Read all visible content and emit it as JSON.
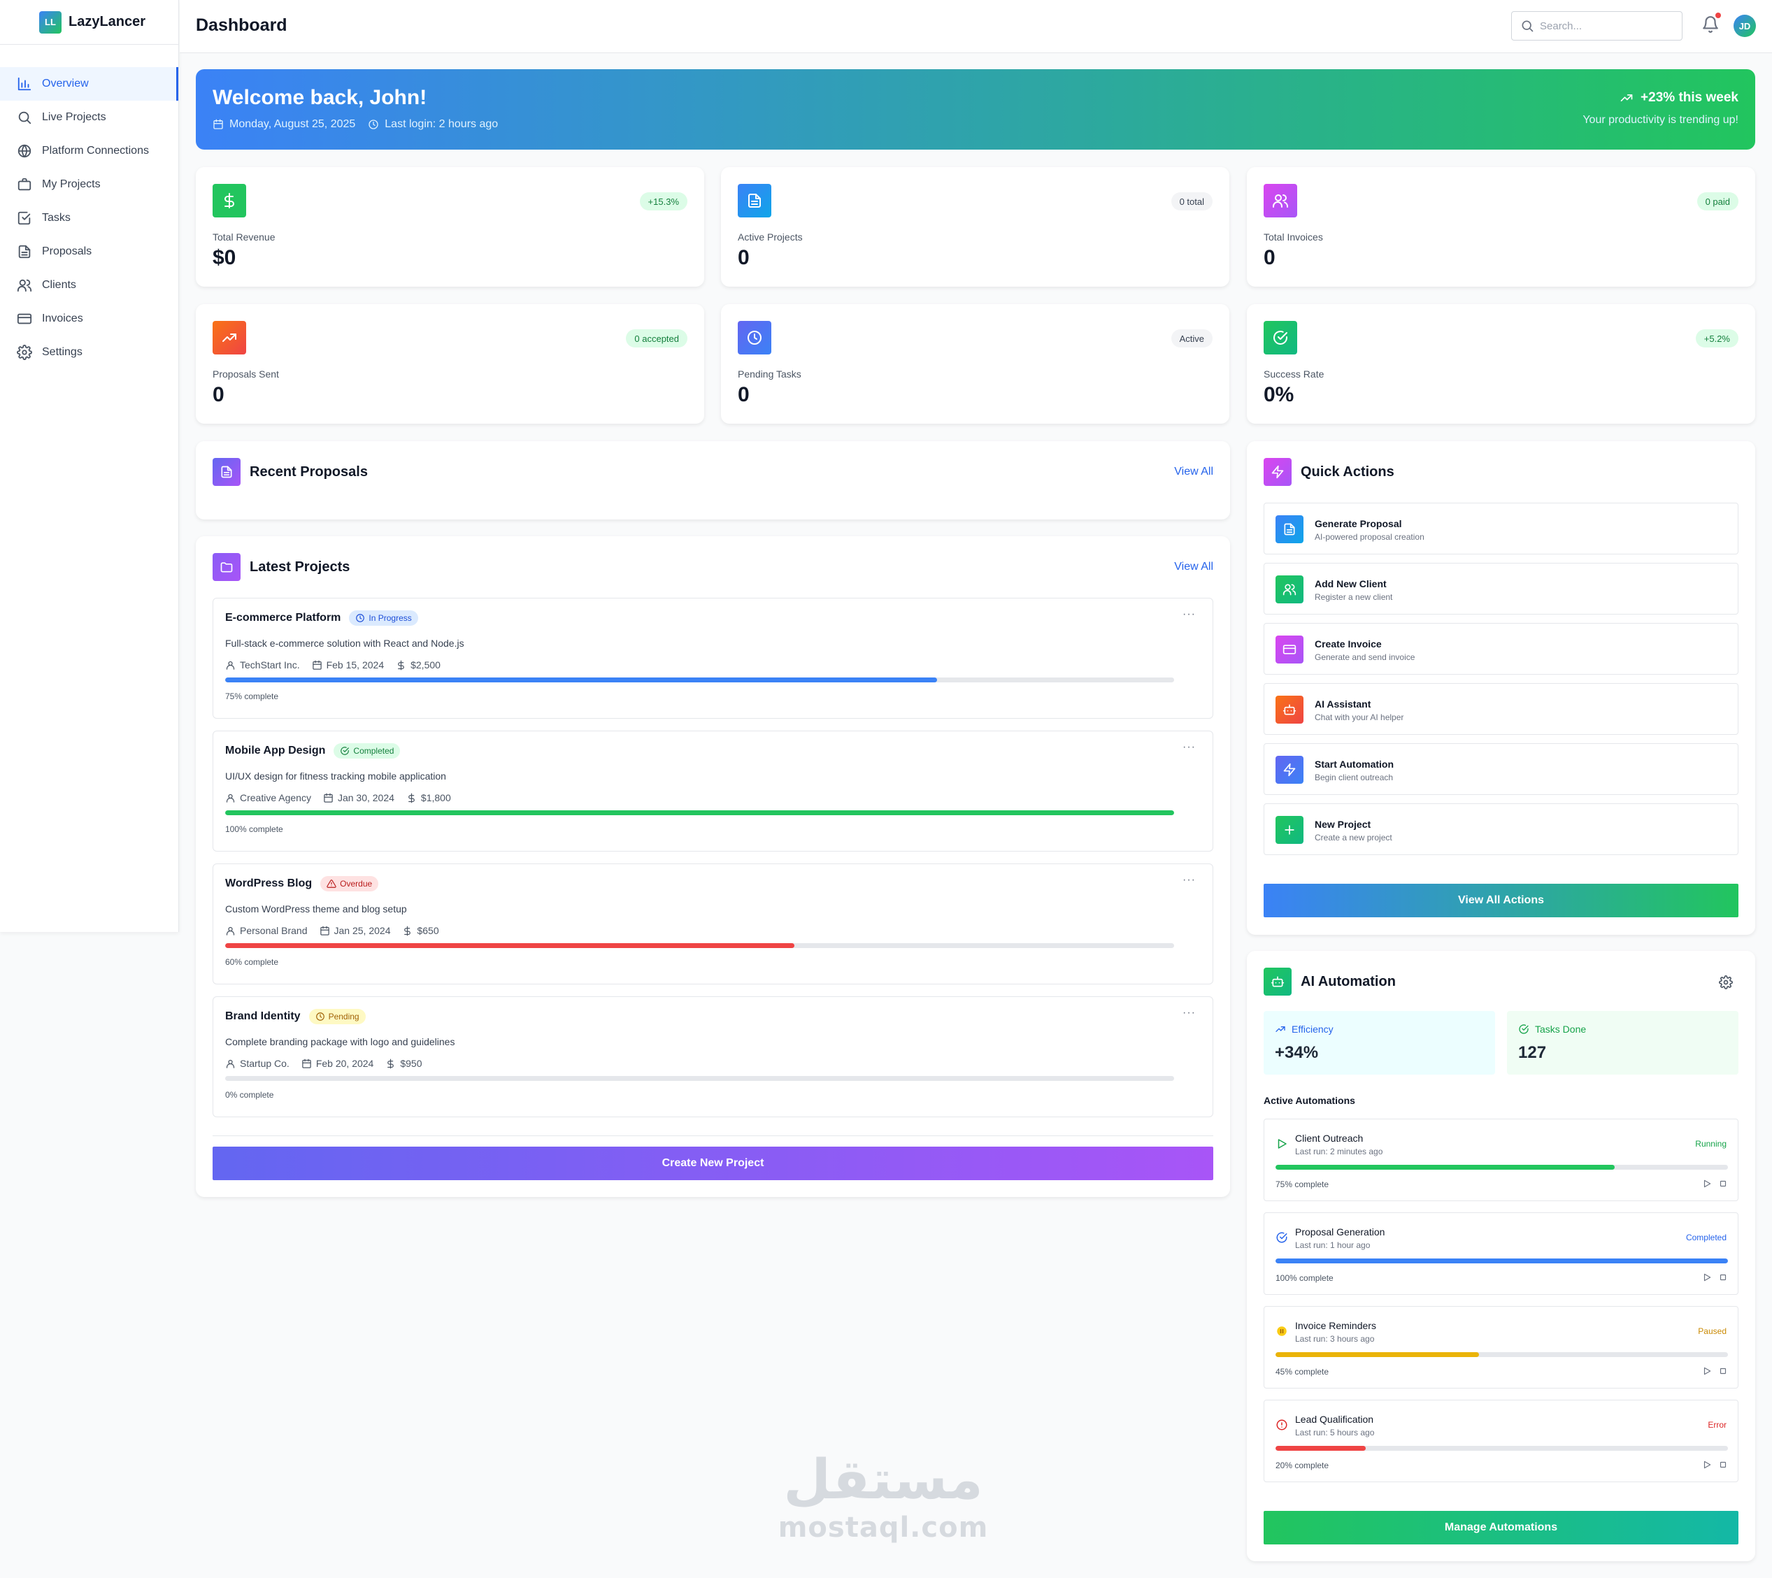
{
  "app": {
    "name": "LazyLancer",
    "logo_text": "LL"
  },
  "sidebar": {
    "items": [
      {
        "label": "Overview",
        "icon": "bar-chart-icon",
        "active": true
      },
      {
        "label": "Live Projects",
        "icon": "search-icon"
      },
      {
        "label": "Platform Connections",
        "icon": "globe-icon"
      },
      {
        "label": "My Projects",
        "icon": "briefcase-icon"
      },
      {
        "label": "Tasks",
        "icon": "check-square-icon"
      },
      {
        "label": "Proposals",
        "icon": "file-text-icon"
      },
      {
        "label": "Clients",
        "icon": "users-icon"
      },
      {
        "label": "Invoices",
        "icon": "credit-card-icon"
      },
      {
        "label": "Settings",
        "icon": "gear-icon"
      }
    ]
  },
  "header": {
    "title": "Dashboard",
    "search_placeholder": "Search...",
    "avatar_initials": "JD"
  },
  "welcome": {
    "title": "Welcome back, John!",
    "date": "Monday, August 25, 2025",
    "last_login": "Last login: 2 hours ago",
    "trend": "+23% this week",
    "trend_sub": "Your productivity is trending up!"
  },
  "stats": [
    {
      "label": "Total Revenue",
      "value": "$0",
      "badge": "+15.3%",
      "icon": "dollar-icon",
      "color": "#22c55e"
    },
    {
      "label": "Active Projects",
      "value": "0",
      "badge": "0 total",
      "icon": "file-text-icon",
      "color": "#3b82f6"
    },
    {
      "label": "Total Invoices",
      "value": "0",
      "badge": "0 paid",
      "icon": "users-icon",
      "color": "#d946ef"
    },
    {
      "label": "Proposals Sent",
      "value": "0",
      "badge": "0 accepted",
      "icon": "trending-up-icon",
      "color": "#f97316"
    },
    {
      "label": "Pending Tasks",
      "value": "0",
      "badge": "Active",
      "icon": "clock-icon",
      "color": "#6366f1"
    },
    {
      "label": "Success Rate",
      "value": "0%",
      "badge": "+5.2%",
      "icon": "check-circle-icon",
      "color": "#10b981"
    }
  ],
  "recent_proposals": {
    "title": "Recent Proposals",
    "view_all": "View All"
  },
  "latest_projects": {
    "title": "Latest Projects",
    "view_all": "View All",
    "create_button": "Create New Project",
    "items": [
      {
        "name": "E-commerce Platform",
        "status": "In Progress",
        "desc": "Full-stack e-commerce solution with React and Node.js",
        "client": "TechStart Inc.",
        "date": "Feb 15, 2024",
        "budget": "$2,500",
        "progress": 75,
        "pct_label": "75% complete",
        "bar_color": "#3b82f6"
      },
      {
        "name": "Mobile App Design",
        "status": "Completed",
        "desc": "UI/UX design for fitness tracking mobile application",
        "client": "Creative Agency",
        "date": "Jan 30, 2024",
        "budget": "$1,800",
        "progress": 100,
        "pct_label": "100% complete",
        "bar_color": "#22c55e"
      },
      {
        "name": "WordPress Blog",
        "status": "Overdue",
        "desc": "Custom WordPress theme and blog setup",
        "client": "Personal Brand",
        "date": "Jan 25, 2024",
        "budget": "$650",
        "progress": 60,
        "pct_label": "60% complete",
        "bar_color": "#ef4444"
      },
      {
        "name": "Brand Identity",
        "status": "Pending",
        "desc": "Complete branding package with logo and guidelines",
        "client": "Startup Co.",
        "date": "Feb 20, 2024",
        "budget": "$950",
        "progress": 0,
        "pct_label": "0% complete",
        "bar_color": "#eab308"
      }
    ]
  },
  "quick_actions": {
    "title": "Quick Actions",
    "view_all_button": "View All Actions",
    "items": [
      {
        "title": "Generate Proposal",
        "sub": "AI-powered proposal creation",
        "icon": "file-text-icon",
        "color": "#3b82f6"
      },
      {
        "title": "Add New Client",
        "sub": "Register a new client",
        "icon": "users-icon",
        "color": "#22c55e"
      },
      {
        "title": "Create Invoice",
        "sub": "Generate and send invoice",
        "icon": "credit-card-icon",
        "color": "#d946ef"
      },
      {
        "title": "AI Assistant",
        "sub": "Chat with your AI helper",
        "icon": "bot-icon",
        "color": "#f97316"
      },
      {
        "title": "Start Automation",
        "sub": "Begin client outreach",
        "icon": "zap-icon",
        "color": "#6366f1"
      },
      {
        "title": "New Project",
        "sub": "Create a new project",
        "icon": "plus-icon",
        "color": "#10b981"
      }
    ]
  },
  "ai_automation": {
    "title": "AI Automation",
    "efficiency_label": "Efficiency",
    "efficiency_value": "+34%",
    "tasks_label": "Tasks Done",
    "tasks_value": "127",
    "active_label": "Active Automations",
    "manage_button": "Manage Automations",
    "items": [
      {
        "name": "Client Outreach",
        "last_run": "Last run: 2 minutes ago",
        "status": "Running",
        "status_color": "#16a34a",
        "progress": 75,
        "pct_label": "75% complete",
        "bar_color": "#22c55e",
        "icon": "play-icon"
      },
      {
        "name": "Proposal Generation",
        "last_run": "Last run: 1 hour ago",
        "status": "Completed",
        "status_color": "#2563eb",
        "progress": 100,
        "pct_label": "100% complete",
        "bar_color": "#3b82f6",
        "icon": "check-circle-icon"
      },
      {
        "name": "Invoice Reminders",
        "last_run": "Last run: 3 hours ago",
        "status": "Paused",
        "status_color": "#ca8a04",
        "progress": 45,
        "pct_label": "45% complete",
        "bar_color": "#eab308",
        "icon": "pause-icon"
      },
      {
        "name": "Lead Qualification",
        "last_run": "Last run: 5 hours ago",
        "status": "Error",
        "status_color": "#dc2626",
        "progress": 20,
        "pct_label": "20% complete",
        "bar_color": "#ef4444",
        "icon": "alert-circle-icon"
      }
    ]
  },
  "watermark": {
    "arabic": "مستقل",
    "latin": "mostaql.com"
  }
}
